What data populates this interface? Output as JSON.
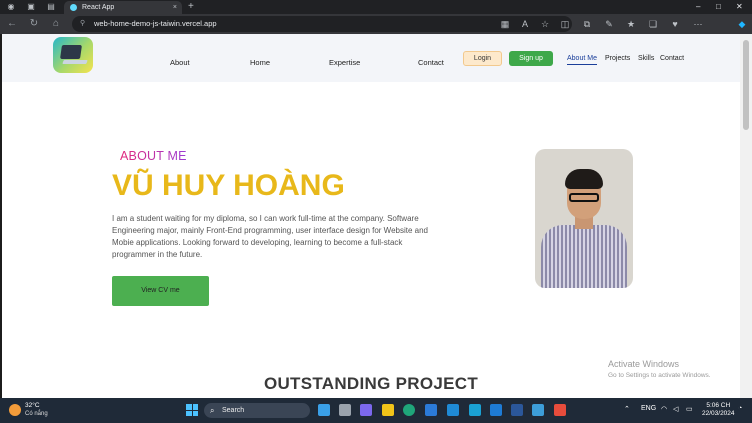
{
  "browser": {
    "tab_title": "React App",
    "tab_close": "×",
    "new_tab": "+",
    "url": "web-home-demo-js-taiwin.vercel.app"
  },
  "header": {
    "nav_items": [
      "About",
      "Home",
      "Expertise",
      "Contact"
    ],
    "login_label": "Login",
    "signup_label": "Sign up",
    "right_nav": [
      "About Me",
      "Projects",
      "Skills",
      "Contact"
    ]
  },
  "hero": {
    "label": "ABOUT ME",
    "name": "VŨ HUY HOÀNG",
    "description": "I am a student waiting for my diploma, so I can work full-time at the company. Software Engineering major, mainly Front-End programming, user interface design for Website and Mobie applications. Looking forward to developing, learning to become a full-stack programmer in the future.",
    "cv_button": "View CV me"
  },
  "section": {
    "title": "OUTSTANDING PROJECT"
  },
  "watermark": {
    "line1": "Activate Windows",
    "line2": "Go to Settings to activate Windows."
  },
  "taskbar": {
    "temperature": "32°C",
    "condition": "Có nắng",
    "search_placeholder": "Search",
    "language": "ENG",
    "time": "5:06 CH",
    "date": "22/03/2024"
  },
  "colors": {
    "accent_green": "#4caf50",
    "name_yellow": "#e8b81a",
    "active_nav": "#1a3e9a"
  }
}
